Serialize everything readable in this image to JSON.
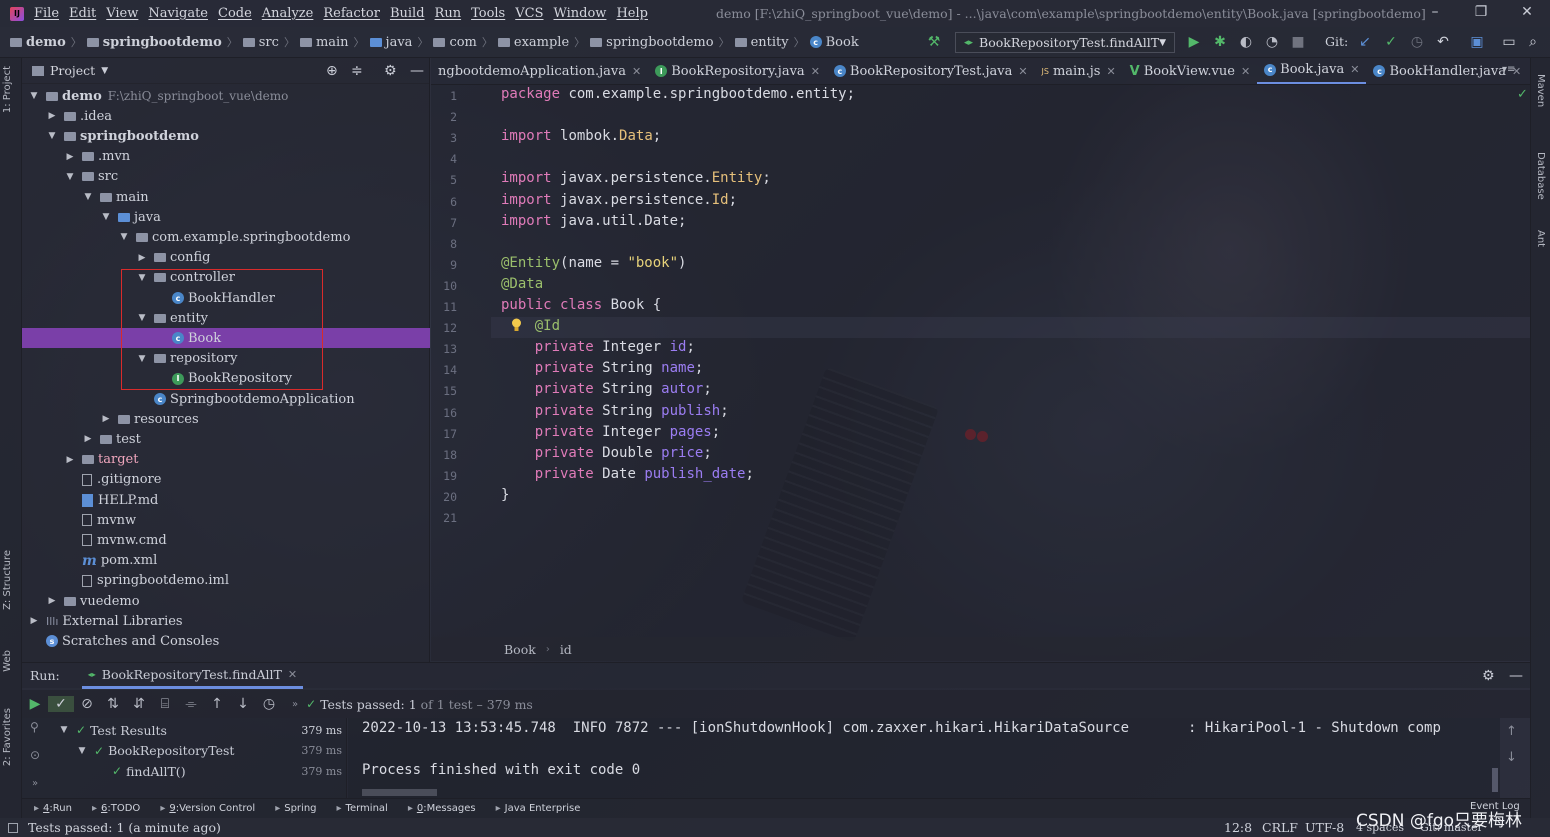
{
  "app": {
    "title": "demo [F:\\zhiQ_springboot_vue\\demo] - ...\\java\\com\\example\\springbootdemo\\entity\\Book.java [springbootdemo]"
  },
  "menu": [
    "File",
    "Edit",
    "View",
    "Navigate",
    "Code",
    "Analyze",
    "Refactor",
    "Build",
    "Run",
    "Tools",
    "VCS",
    "Window",
    "Help"
  ],
  "window_buttons": {
    "minimize": "–",
    "restore": "❐",
    "close": "✕"
  },
  "breadcrumb": [
    {
      "label": "demo",
      "bold": true,
      "icon": "folder"
    },
    {
      "label": "springbootdemo",
      "bold": true,
      "icon": "folder"
    },
    {
      "label": "src",
      "icon": "folder"
    },
    {
      "label": "main",
      "icon": "folder"
    },
    {
      "label": "java",
      "icon": "folder-blue"
    },
    {
      "label": "com",
      "icon": "folder"
    },
    {
      "label": "example",
      "icon": "folder"
    },
    {
      "label": "springbootdemo",
      "icon": "folder"
    },
    {
      "label": "entity",
      "icon": "folder"
    },
    {
      "label": "Book",
      "icon": "class"
    }
  ],
  "toolbar": {
    "run_config": "BookRepositoryTest.findAllT",
    "git_label": "Git:"
  },
  "project_panel": {
    "title": "Project"
  },
  "tree": [
    {
      "label": "demo",
      "hint": "F:\\zhiQ_springboot_vue\\demo",
      "depth": 0,
      "arrow": "open",
      "icon": "folder",
      "bold": true
    },
    {
      "label": ".idea",
      "depth": 1,
      "arrow": "closed",
      "icon": "folder"
    },
    {
      "label": "springbootdemo",
      "depth": 1,
      "arrow": "open",
      "icon": "folder",
      "bold": true
    },
    {
      "label": ".mvn",
      "depth": 2,
      "arrow": "closed",
      "icon": "folder"
    },
    {
      "label": "src",
      "depth": 2,
      "arrow": "open",
      "icon": "folder"
    },
    {
      "label": "main",
      "depth": 3,
      "arrow": "open",
      "icon": "folder"
    },
    {
      "label": "java",
      "depth": 4,
      "arrow": "open",
      "icon": "folder-blue"
    },
    {
      "label": "com.example.springbootdemo",
      "depth": 5,
      "arrow": "open",
      "icon": "package"
    },
    {
      "label": "config",
      "depth": 6,
      "arrow": "closed",
      "icon": "package"
    },
    {
      "label": "controller",
      "depth": 6,
      "arrow": "open",
      "icon": "package"
    },
    {
      "label": "BookHandler",
      "depth": 7,
      "arrow": "none",
      "icon": "class"
    },
    {
      "label": "entity",
      "depth": 6,
      "arrow": "open",
      "icon": "package"
    },
    {
      "label": "Book",
      "depth": 7,
      "arrow": "none",
      "icon": "class",
      "selected": true
    },
    {
      "label": "repository",
      "depth": 6,
      "arrow": "open",
      "icon": "package"
    },
    {
      "label": "BookRepository",
      "depth": 7,
      "arrow": "none",
      "icon": "interface"
    },
    {
      "label": "SpringbootdemoApplication",
      "depth": 6,
      "arrow": "none",
      "icon": "spring-class"
    },
    {
      "label": "resources",
      "depth": 4,
      "arrow": "closed",
      "icon": "folder"
    },
    {
      "label": "test",
      "depth": 3,
      "arrow": "closed",
      "icon": "folder"
    },
    {
      "label": "target",
      "depth": 2,
      "arrow": "closed",
      "icon": "folder",
      "excluded": true
    },
    {
      "label": ".gitignore",
      "depth": 2,
      "arrow": "none",
      "icon": "file"
    },
    {
      "label": "HELP.md",
      "depth": 2,
      "arrow": "none",
      "icon": "md-file"
    },
    {
      "label": "mvnw",
      "depth": 2,
      "arrow": "none",
      "icon": "file"
    },
    {
      "label": "mvnw.cmd",
      "depth": 2,
      "arrow": "none",
      "icon": "file"
    },
    {
      "label": "pom.xml",
      "depth": 2,
      "arrow": "none",
      "icon": "maven"
    },
    {
      "label": "springbootdemo.iml",
      "depth": 2,
      "arrow": "none",
      "icon": "file"
    },
    {
      "label": "vuedemo",
      "depth": 1,
      "arrow": "closed",
      "icon": "folder"
    },
    {
      "label": "External Libraries",
      "depth": 0,
      "arrow": "closed",
      "icon": "library"
    },
    {
      "label": "Scratches and Consoles",
      "depth": 0,
      "arrow": "none",
      "icon": "scratch"
    }
  ],
  "tabs": [
    {
      "label": "ngbootdemoApplication.java",
      "icon": "none"
    },
    {
      "label": "BookRepository.java",
      "icon": "interface"
    },
    {
      "label": "BookRepositoryTest.java",
      "icon": "class"
    },
    {
      "label": "main.js",
      "icon": "js"
    },
    {
      "label": "BookView.vue",
      "icon": "vue"
    },
    {
      "label": "Book.java",
      "icon": "class",
      "active": true
    },
    {
      "label": "BookHandler.java",
      "icon": "class"
    }
  ],
  "code": [
    [
      [
        "kw",
        "package "
      ],
      [
        "",
        "com.example.springbootdemo.entity;"
      ]
    ],
    [],
    [
      [
        "kw",
        "import "
      ],
      [
        "",
        "lombok."
      ],
      [
        "ty",
        "Data"
      ],
      [
        "",
        ";"
      ]
    ],
    [],
    [
      [
        "kw",
        "import "
      ],
      [
        "",
        "javax.persistence."
      ],
      [
        "ty",
        "Entity"
      ],
      [
        "",
        ";"
      ]
    ],
    [
      [
        "kw",
        "import "
      ],
      [
        "",
        "javax.persistence."
      ],
      [
        "ty",
        "Id"
      ],
      [
        "",
        ";"
      ]
    ],
    [
      [
        "kw",
        "import "
      ],
      [
        "",
        "java.util.Date;"
      ]
    ],
    [],
    [
      [
        "ann",
        "@Entity"
      ],
      [
        "",
        "(name = "
      ],
      [
        "str",
        "\"book\""
      ],
      [
        "",
        ")"
      ]
    ],
    [
      [
        "ann",
        "@Data"
      ]
    ],
    [
      [
        "kw",
        "public class "
      ],
      [
        "",
        "Book {"
      ]
    ],
    [
      [
        "",
        "    "
      ],
      [
        "ann",
        "@Id"
      ]
    ],
    [
      [
        "",
        "    "
      ],
      [
        "kw",
        "private "
      ],
      [
        "",
        "Integer "
      ],
      [
        "fld",
        "id"
      ],
      [
        "",
        ";"
      ]
    ],
    [
      [
        "",
        "    "
      ],
      [
        "kw",
        "private "
      ],
      [
        "",
        "String "
      ],
      [
        "fld",
        "name"
      ],
      [
        "",
        ";"
      ]
    ],
    [
      [
        "",
        "    "
      ],
      [
        "kw",
        "private "
      ],
      [
        "",
        "String "
      ],
      [
        "fld",
        "autor"
      ],
      [
        "",
        ";"
      ]
    ],
    [
      [
        "",
        "    "
      ],
      [
        "kw",
        "private "
      ],
      [
        "",
        "String "
      ],
      [
        "fld",
        "publish"
      ],
      [
        "",
        ";"
      ]
    ],
    [
      [
        "",
        "    "
      ],
      [
        "kw",
        "private "
      ],
      [
        "",
        "Integer "
      ],
      [
        "fld",
        "pages"
      ],
      [
        "",
        ";"
      ]
    ],
    [
      [
        "",
        "    "
      ],
      [
        "kw",
        "private "
      ],
      [
        "",
        "Double "
      ],
      [
        "fld",
        "price"
      ],
      [
        "",
        ";"
      ]
    ],
    [
      [
        "",
        "    "
      ],
      [
        "kw",
        "private "
      ],
      [
        "",
        "Date "
      ],
      [
        "fld",
        "publish_date"
      ],
      [
        "",
        ";"
      ]
    ],
    [
      [
        "",
        "}"
      ]
    ],
    []
  ],
  "editor_breadcrumb": [
    "Book",
    "id"
  ],
  "run": {
    "label": "Run:",
    "tab": "BookRepositoryTest.findAllT",
    "summary_prefix": "Tests passed:",
    "summary_count": "1",
    "summary_rest": "of 1 test – 379 ms",
    "results": [
      {
        "label": "Test Results",
        "ms": "379 ms",
        "depth": 0
      },
      {
        "label": "BookRepositoryTest",
        "ms": "379 ms",
        "depth": 1
      },
      {
        "label": "findAllT()",
        "ms": "379 ms",
        "depth": 2
      }
    ],
    "console": [
      "2022-10-13 13:53:45.748  INFO 7872 --- [ionShutdownHook] com.zaxxer.hikari.HikariDataSource       : HikariPool-1 - Shutdown comp",
      "",
      "Process finished with exit code 0"
    ]
  },
  "tool_windows": [
    {
      "num": "4",
      "label": "Run",
      "icon": "run-icon"
    },
    {
      "num": "6",
      "label": "TODO",
      "icon": "todo-icon"
    },
    {
      "num": "9",
      "label": "Version Control",
      "icon": "vcs-icon"
    },
    {
      "num": "",
      "label": "Spring",
      "icon": "spring-icon"
    },
    {
      "num": "",
      "label": "Terminal",
      "icon": "terminal-icon"
    },
    {
      "num": "0",
      "label": "Messages",
      "icon": "messages-icon"
    },
    {
      "num": "",
      "label": "Java Enterprise",
      "icon": "java-enterprise-icon"
    }
  ],
  "event_log": "Event Log",
  "status": {
    "message": "Tests passed: 1 (a minute ago)",
    "position": "12:8",
    "line_sep": "CRLF",
    "encoding": "UTF-8",
    "indent": "4 spaces",
    "git": "Git: master"
  },
  "side_labels": {
    "left": [
      "1: Project",
      "Z: Structure",
      "Web",
      "2: Favorites"
    ],
    "right": [
      "Maven",
      "Database",
      "Ant"
    ]
  },
  "watermark": "CSDN @fgo只要梅林"
}
